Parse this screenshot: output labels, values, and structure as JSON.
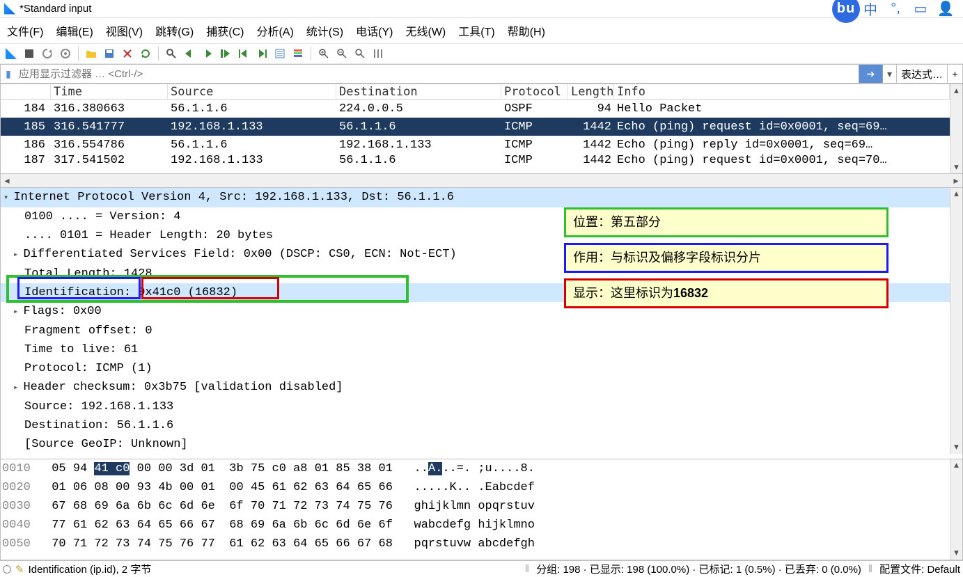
{
  "title": "*Standard input",
  "menu": {
    "file": "文件(F)",
    "edit": "编辑(E)",
    "view": "视图(V)",
    "go": "跳转(G)",
    "capture": "捕获(C)",
    "analyze": "分析(A)",
    "statistics": "统计(S)",
    "telephony": "电话(Y)",
    "wireless": "无线(W)",
    "tools": "工具(T)",
    "help": "帮助(H)"
  },
  "filter": {
    "placeholder": "应用显示过滤器 … <Ctrl-/>",
    "expression": "表达式…"
  },
  "columns": {
    "no": "",
    "time": "Time",
    "source": "Source",
    "destination": "Destination",
    "protocol": "Protocol",
    "length": "Length",
    "info": "Info"
  },
  "packets": [
    {
      "no": "184",
      "time": "316.380663",
      "src": "56.1.1.6",
      "dst": "224.0.0.5",
      "proto": "OSPF",
      "len": "94",
      "info": "Hello Packet",
      "sel": false
    },
    {
      "no": "185",
      "time": "316.541777",
      "src": "192.168.1.133",
      "dst": "56.1.1.6",
      "proto": "ICMP",
      "len": "1442",
      "info": "Echo (ping) request  id=0x0001, seq=69…",
      "sel": true
    },
    {
      "no": "186",
      "time": "316.554786",
      "src": "56.1.1.6",
      "dst": "192.168.1.133",
      "proto": "ICMP",
      "len": "1442",
      "info": "Echo (ping) reply    id=0x0001, seq=69…",
      "sel": false
    },
    {
      "no": "187",
      "time": "317.541502",
      "src": "192.168.1.133",
      "dst": "56.1.1.6",
      "proto": "ICMP",
      "len": "1442",
      "info": "Echo (ping) request  id=0x0001, seq=70…",
      "sel": false
    }
  ],
  "detail": {
    "root": "Internet Protocol Version 4, Src: 192.168.1.133, Dst: 56.1.1.6",
    "version": "0100 .... = Version: 4",
    "hlen": ".... 0101 = Header Length: 20 bytes",
    "dsf": "Differentiated Services Field: 0x00 (DSCP: CS0, ECN: Not-ECT)",
    "totlen": "Total Length: 1428",
    "ident_label": "Identification:",
    "ident_value": " 0x41c0 (16832)",
    "flags": "Flags: 0x00",
    "fragoff": "Fragment offset: 0",
    "ttl": "Time to live: 61",
    "proto": "Protocol: ICMP (1)",
    "chksum": "Header checksum: 0x3b75 [validation disabled]",
    "src": "Source: 192.168.1.133",
    "dst": "Destination: 56.1.1.6",
    "geoip": "[Source GeoIP: Unknown]"
  },
  "annotations": {
    "pos": "位置：第五部分",
    "role": "作用：与标识及偏移字段标识分片",
    "disp_prefix": "显示：这里标识为",
    "disp_bold": "16832"
  },
  "hex": {
    "rows": [
      {
        "off": "0010",
        "b1": "05 94 ",
        "hl": "41 c0",
        "b2": " 00 00 3d 01",
        "b3": "3b 75 c0 a8 01 85 38 01",
        "a1": "..",
        "ahl": "A.",
        "a2": "..=. ;u....8."
      },
      {
        "off": "0020",
        "b1": "01 06 08 00 93 4b 00 01",
        "b2": "",
        "b3": "00 45 61 62 63 64 65 66",
        "a1": ".....K.. .Eabcdef",
        "ahl": "",
        "a2": ""
      },
      {
        "off": "0030",
        "b1": "67 68 69 6a 6b 6c 6d 6e",
        "b2": "",
        "b3": "6f 70 71 72 73 74 75 76",
        "a1": "ghijklmn opqrstuv",
        "ahl": "",
        "a2": ""
      },
      {
        "off": "0040",
        "b1": "77 61 62 63 64 65 66 67",
        "b2": "",
        "b3": "68 69 6a 6b 6c 6d 6e 6f",
        "a1": "wabcdefg hijklmno",
        "ahl": "",
        "a2": ""
      },
      {
        "off": "0050",
        "b1": "70 71 72 73 74 75 76 77",
        "b2": "",
        "b3": "61 62 63 64 65 66 67 68",
        "a1": "pqrstuvw abcdefgh",
        "ahl": "",
        "a2": ""
      }
    ]
  },
  "status": {
    "field": "Identification (ip.id), 2 字节",
    "packets": "分组: 198 · 已显示: 198 (100.0%) · 已标记: 1 (0.5%) · 已丢弃: 0 (0.0%)",
    "profile": "配置文件: Default"
  }
}
